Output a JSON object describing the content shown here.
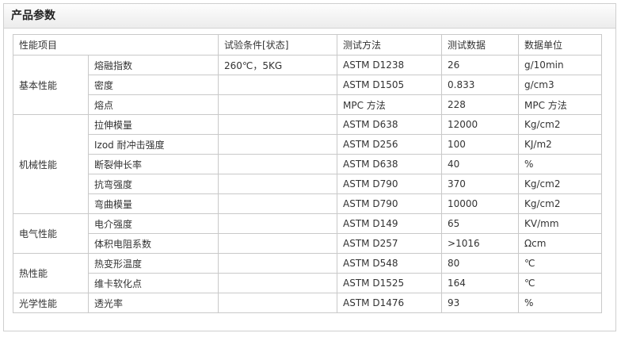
{
  "panel": {
    "title": "产品参数"
  },
  "table": {
    "headers": {
      "property": "性能项目",
      "condition": "试验条件[状态]",
      "method": "测试方法",
      "data": "测试数据",
      "unit": "数据单位"
    },
    "groups": [
      {
        "name": "基本性能",
        "rows": [
          {
            "item": "熔融指数",
            "condition": "260℃，5KG",
            "method": "ASTM D1238",
            "value": "26",
            "unit": "g/10min"
          },
          {
            "item": "密度",
            "condition": "",
            "method": "ASTM D1505",
            "value": "0.833",
            "unit": "g/cm3"
          },
          {
            "item": "熔点",
            "condition": "",
            "method": "MPC 方法",
            "value": "228",
            "unit": "MPC 方法"
          }
        ]
      },
      {
        "name": "机械性能",
        "rows": [
          {
            "item": "拉伸模量",
            "condition": "",
            "method": "ASTM D638",
            "value": "12000",
            "unit": "Kg/cm2"
          },
          {
            "item": "Izod 耐冲击强度",
            "condition": "",
            "method": "ASTM D256",
            "value": "100",
            "unit": "KJ/m2"
          },
          {
            "item": "断裂伸长率",
            "condition": "",
            "method": "ASTM D638",
            "value": "40",
            "unit": "%"
          },
          {
            "item": "抗弯强度",
            "condition": "",
            "method": "ASTM D790",
            "value": "370",
            "unit": "Kg/cm2"
          },
          {
            "item": "弯曲模量",
            "condition": "",
            "method": "ASTM D790",
            "value": "10000",
            "unit": "Kg/cm2"
          }
        ]
      },
      {
        "name": "电气性能",
        "rows": [
          {
            "item": "电介强度",
            "condition": "",
            "method": "ASTM D149",
            "value": "65",
            "unit": "KV/mm"
          },
          {
            "item": "体积电阻系数",
            "condition": "",
            "method": "ASTM D257",
            "value": ">1016",
            "unit": "Ωcm"
          }
        ]
      },
      {
        "name": "热性能",
        "rows": [
          {
            "item": "热变形温度",
            "condition": "",
            "method": "ASTM D548",
            "value": "80",
            "unit": "℃"
          },
          {
            "item": "维卡软化点",
            "condition": "",
            "method": "ASTM D1525",
            "value": "164",
            "unit": "℃"
          }
        ]
      },
      {
        "name": "光学性能",
        "rows": [
          {
            "item": "透光率",
            "condition": "",
            "method": "ASTM D1476",
            "value": "93",
            "unit": "%"
          }
        ]
      }
    ]
  }
}
